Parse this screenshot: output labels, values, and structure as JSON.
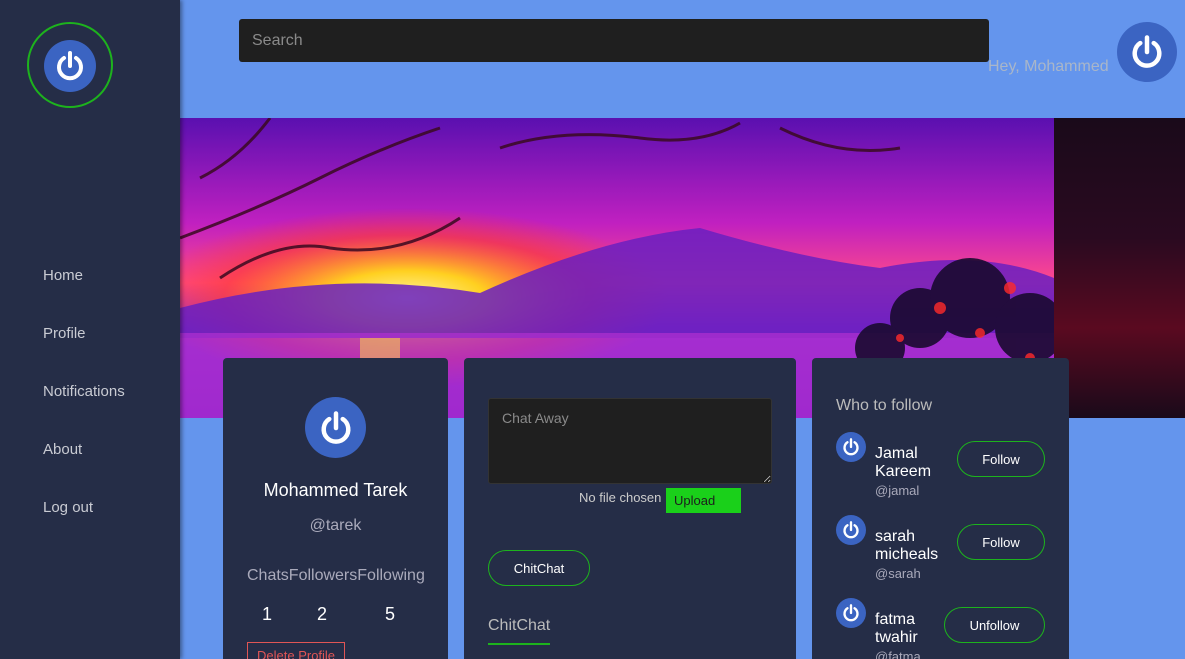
{
  "sidebar": {
    "items": [
      {
        "label": "Home"
      },
      {
        "label": "Profile"
      },
      {
        "label": "Notifications"
      },
      {
        "label": "About"
      },
      {
        "label": "Log out"
      }
    ]
  },
  "header": {
    "search_placeholder": "Search",
    "greeting": "Hey, Mohammed"
  },
  "profile": {
    "name": "Mohammed Tarek",
    "handle": "@tarek",
    "stats": [
      {
        "label": "Chats",
        "value": "1"
      },
      {
        "label": "Followers",
        "value": "2"
      },
      {
        "label": "Following",
        "value": "5"
      }
    ],
    "delete_label": "Delete Profile"
  },
  "chat": {
    "placeholder": "Chat Away",
    "file_status": "No file chosen",
    "upload_label": "Upload",
    "submit_label": "ChitChat",
    "tab_label": "ChitChat"
  },
  "follow": {
    "title": "Who to follow",
    "users": [
      {
        "name": "Jamal Kareem",
        "handle": "@jamal",
        "action": "Follow"
      },
      {
        "name": "sarah micheals",
        "handle": "@sarah",
        "action": "Follow"
      },
      {
        "name": "fatma twahir",
        "handle": "@fatma",
        "action": "Unfollow"
      }
    ]
  },
  "colors": {
    "sidebar_bg": "#252d47",
    "page_bg": "#6495ed",
    "accent_green": "#1db31d",
    "danger": "#e05555",
    "upload_green": "#1ad01a"
  },
  "icons": {
    "logo": "power-icon",
    "avatar": "power-icon"
  }
}
